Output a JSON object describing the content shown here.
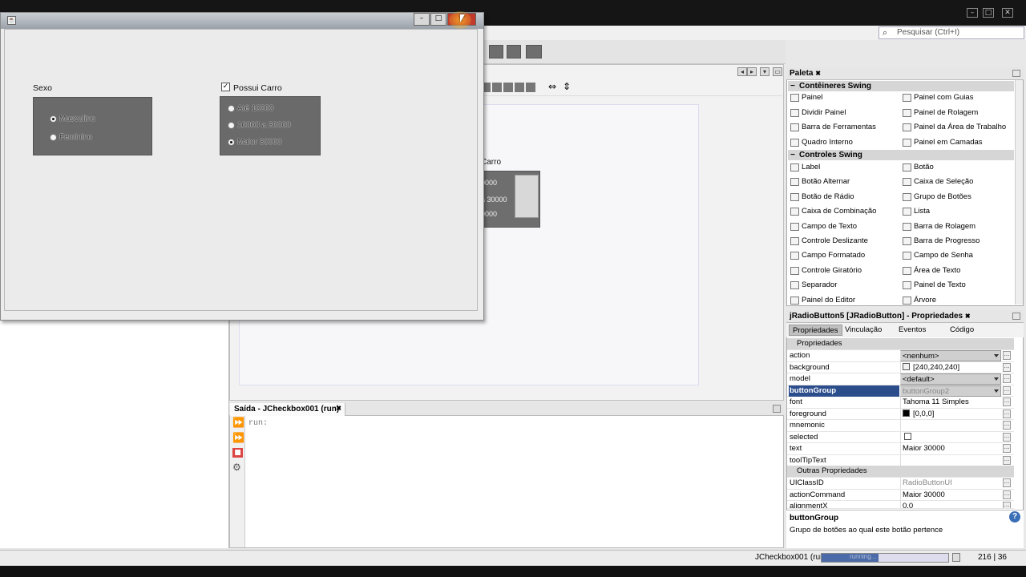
{
  "ide": {
    "search_placeholder": "Pesquisar (Ctrl+I)",
    "search_icon": "magnifier-icon"
  },
  "app_window": {
    "minimize": "–",
    "maximize": "□",
    "close": "✕",
    "sexo_label": "Sexo",
    "sexo_options": [
      {
        "label": "Masculino",
        "selected": true
      },
      {
        "label": "Feminino",
        "selected": false
      }
    ],
    "car_checkbox_label": "Possui Carro",
    "car_checkbox_checked": true,
    "car_options": [
      {
        "label": "Até 10000",
        "selected": false
      },
      {
        "label": "10000 a 30000",
        "selected": false
      },
      {
        "label": "Maior 30000",
        "selected": true
      }
    ]
  },
  "canvas_preview": {
    "label1": "Carro",
    "label2": "0000",
    "label3": "a 30000",
    "label4": "0000"
  },
  "output": {
    "tab_title": "Saída - JCheckbox001 (run)",
    "tab_close": "✖",
    "text": "run:"
  },
  "palette": {
    "title": "Paleta",
    "close": "✖",
    "categories": [
      "Contêineres Swing",
      "Controles Swing"
    ],
    "containers": [
      "Painel",
      "Painel com Guias",
      "Dividir Painel",
      "Painel de Rolagem",
      "Barra de Ferramentas",
      "Painel da Área de Trabalho",
      "Quadro Interno",
      "Painel em Camadas"
    ],
    "controls": [
      "Label",
      "Botão",
      "Botão Alternar",
      "Caixa de Seleção",
      "Botão de Rádio",
      "Grupo de Botões",
      "Caixa de Combinação",
      "Lista",
      "Campo de Texto",
      "Barra de Rolagem",
      "Controle Deslizante",
      "Barra de Progresso",
      "Campo Formatado",
      "Campo de Senha",
      "Controle Giratório",
      "Área de Texto",
      "Separador",
      "Painel de Texto",
      "Painel do Editor",
      "Árvore"
    ]
  },
  "properties": {
    "title": "jRadioButton5 [JRadioButton] - Propriedades",
    "close": "✖",
    "tabs": [
      "Propriedades",
      "Vinculação",
      "Eventos",
      "Código"
    ],
    "section1": "Propriedades",
    "section2": "Outras Propriedades",
    "rows": [
      {
        "key": "action",
        "value": "<nenhum>"
      },
      {
        "key": "background",
        "value": "[240,240,240]"
      },
      {
        "key": "model",
        "value": "<default>"
      },
      {
        "key": "buttonGroup",
        "value": "buttonGroup2"
      },
      {
        "key": "font",
        "value": "Tahoma 11 Simples"
      },
      {
        "key": "foreground",
        "value": "[0,0,0]"
      },
      {
        "key": "mnemonic",
        "value": ""
      },
      {
        "key": "selected",
        "value": ""
      },
      {
        "key": "text",
        "value": "Maior 30000"
      },
      {
        "key": "toolTipText",
        "value": ""
      }
    ],
    "other_rows": [
      {
        "key": "UIClassID",
        "value": "RadioButtonUI"
      },
      {
        "key": "actionCommand",
        "value": "Maior 30000"
      },
      {
        "key": "alignmentX",
        "value": "0.0"
      }
    ],
    "desc_title": "buttonGroup",
    "desc_text": "Grupo de botões ao qual este botão pertence",
    "help": "?"
  },
  "status": {
    "run_label": "JCheckbox001 (run)",
    "progress_text": "running...",
    "progress": 0.45,
    "position": "216 | 36"
  }
}
